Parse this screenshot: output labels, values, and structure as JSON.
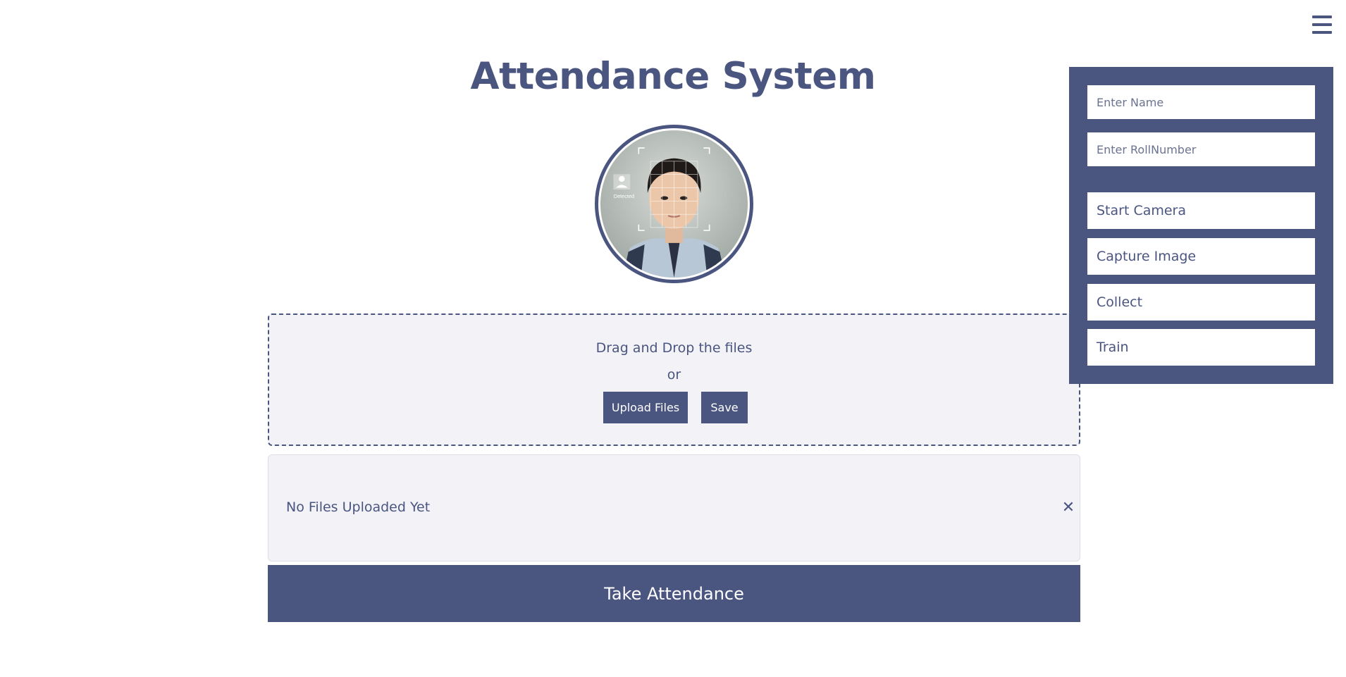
{
  "header": {
    "title": "Attendance System"
  },
  "avatar": {
    "overlay_label": "Detected"
  },
  "dropzone": {
    "instruction": "Drag and Drop the files",
    "separator": "or",
    "upload_label": "Upload Files",
    "save_label": "Save"
  },
  "file_list": {
    "empty_message": "No Files Uploaded Yet",
    "close_symbol": "✕"
  },
  "actions": {
    "take_attendance_label": "Take Attendance"
  },
  "side_panel": {
    "name_placeholder": "Enter Name",
    "roll_placeholder": "Enter RollNumber",
    "buttons": [
      {
        "label": "Start Camera"
      },
      {
        "label": "Capture Image"
      },
      {
        "label": "Collect"
      },
      {
        "label": "Train"
      }
    ]
  },
  "icons": {
    "menu": "hamburger-menu-icon",
    "close": "close-icon"
  },
  "colors": {
    "primary": "#4a5580",
    "surface": "#f2f2f7",
    "background": "#ffffff"
  }
}
